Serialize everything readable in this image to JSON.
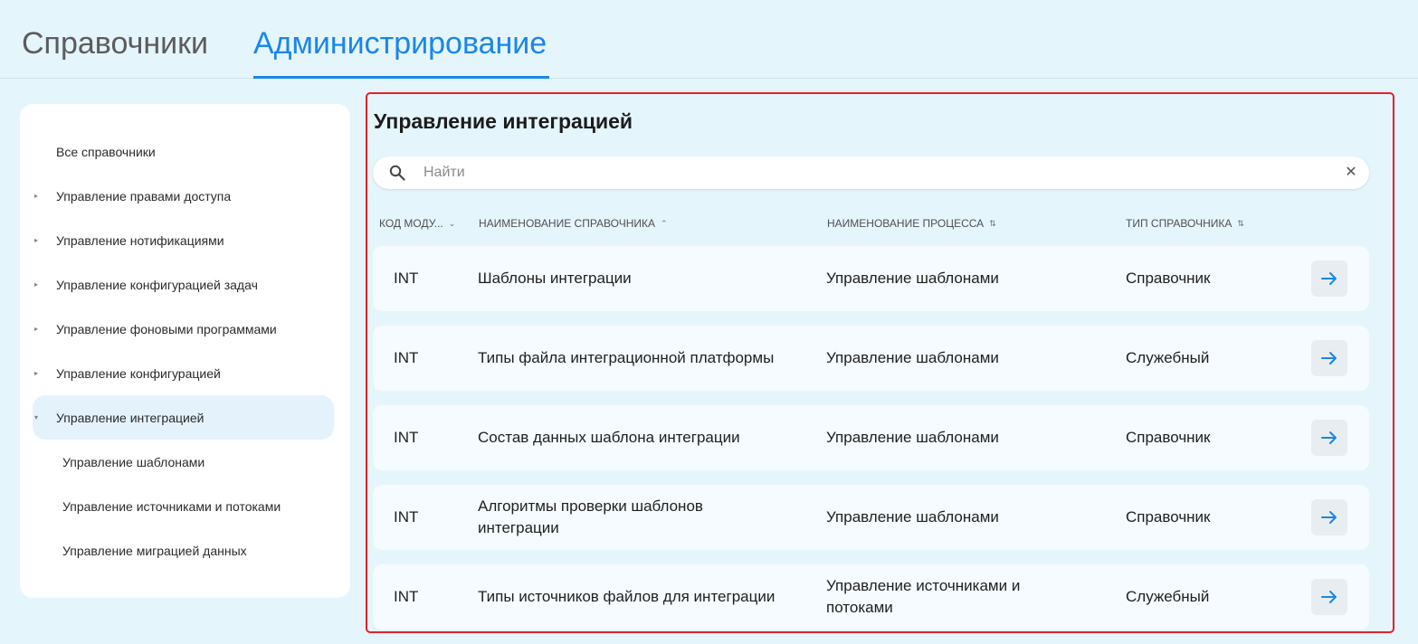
{
  "tabs": [
    {
      "label": "Справочники",
      "active": false
    },
    {
      "label": "Администрирование",
      "active": true
    }
  ],
  "sidebar": {
    "items": [
      {
        "label": "Все справочники",
        "caret": "none"
      },
      {
        "label": "Управление правами доступа",
        "caret": "right"
      },
      {
        "label": "Управление нотификациями",
        "caret": "right"
      },
      {
        "label": "Управление конфигурацией задач",
        "caret": "right"
      },
      {
        "label": "Управление фоновыми программами",
        "caret": "right"
      },
      {
        "label": "Управление конфигурацией",
        "caret": "right"
      },
      {
        "label": "Управление интеграцией",
        "caret": "down",
        "active": true
      },
      {
        "label": "Управление шаблонами",
        "caret": "none",
        "sub": true
      },
      {
        "label": "Управление источниками и потоками",
        "caret": "none",
        "sub": true
      },
      {
        "label": "Управление миграцией данных",
        "caret": "none",
        "sub": true
      }
    ]
  },
  "main": {
    "title": "Управление интеграцией",
    "search": {
      "placeholder": "Найти",
      "value": ""
    },
    "columns": [
      {
        "label": "КОД МОДУ...",
        "sort_icon": "chevron-down"
      },
      {
        "label": "НАИМЕНОВАНИЕ СПРАВОЧНИКА",
        "sort_icon": "chevron-up"
      },
      {
        "label": "НАИМЕНОВАНИЕ ПРОЦЕССА",
        "sort_icon": "sort-both"
      },
      {
        "label": "ТИП СПРАВОЧНИКА",
        "sort_icon": "sort-both"
      }
    ],
    "rows": [
      {
        "code": "INT",
        "name": "Шаблоны интеграции",
        "process": "Управление шаблонами",
        "type": "Справочник"
      },
      {
        "code": "INT",
        "name": "Типы файла интеграционной платформы",
        "process": "Управление шаблонами",
        "type": "Служебный"
      },
      {
        "code": "INT",
        "name": "Состав данных шаблона интеграции",
        "process": "Управление шаблонами",
        "type": "Справочник"
      },
      {
        "code": "INT",
        "name": "Алгоритмы проверки шаблонов интеграции",
        "process": "Управление шаблонами",
        "type": "Справочник"
      },
      {
        "code": "INT",
        "name": "Типы источников файлов для интеграции",
        "process": "Управление источниками и потоками",
        "type": "Служебный"
      }
    ]
  },
  "colors": {
    "accent": "#1a86e8",
    "page_bg": "#e5f5fc",
    "highlight_border": "#e5202a",
    "active_item_bg": "#e4f2fc"
  }
}
